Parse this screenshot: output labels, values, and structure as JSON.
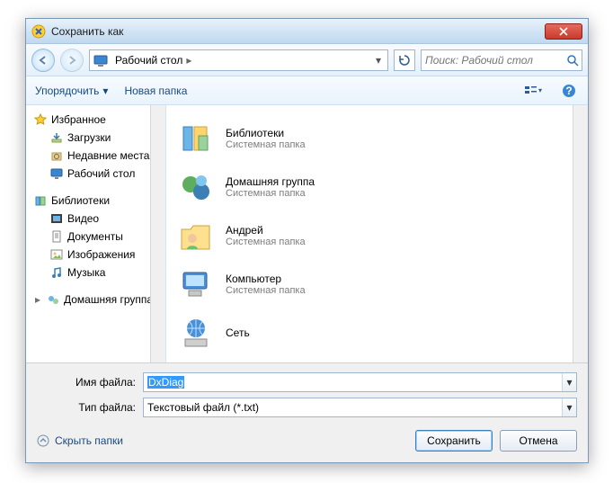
{
  "title": "Сохранить как",
  "nav": {
    "location": "Рабочий стол",
    "search_placeholder": "Поиск: Рабочий стол"
  },
  "toolbar": {
    "organize": "Упорядочить",
    "new_folder": "Новая папка"
  },
  "tree": {
    "favorites": {
      "label": "Избранное"
    },
    "favorites_items": [
      {
        "label": "Загрузки"
      },
      {
        "label": "Недавние места"
      },
      {
        "label": "Рабочий стол"
      }
    ],
    "libraries": {
      "label": "Библиотеки"
    },
    "libraries_items": [
      {
        "label": "Видео"
      },
      {
        "label": "Документы"
      },
      {
        "label": "Изображения"
      },
      {
        "label": "Музыка"
      }
    ],
    "homegroup": {
      "label": "Домашняя группа"
    }
  },
  "items": [
    {
      "primary": "Библиотеки",
      "secondary": "Системная папка"
    },
    {
      "primary": "Домашняя группа",
      "secondary": "Системная папка"
    },
    {
      "primary": "Андрей",
      "secondary": "Системная папка"
    },
    {
      "primary": "Компьютер",
      "secondary": "Системная папка"
    },
    {
      "primary": "Сеть",
      "secondary": ""
    }
  ],
  "filename_label": "Имя файла:",
  "filetype_label": "Тип файла:",
  "filename_value": "DxDiag",
  "filetype_value": "Текстовый файл (*.txt)",
  "hide_folders": "Скрыть папки",
  "save_label": "Сохранить",
  "cancel_label": "Отмена"
}
